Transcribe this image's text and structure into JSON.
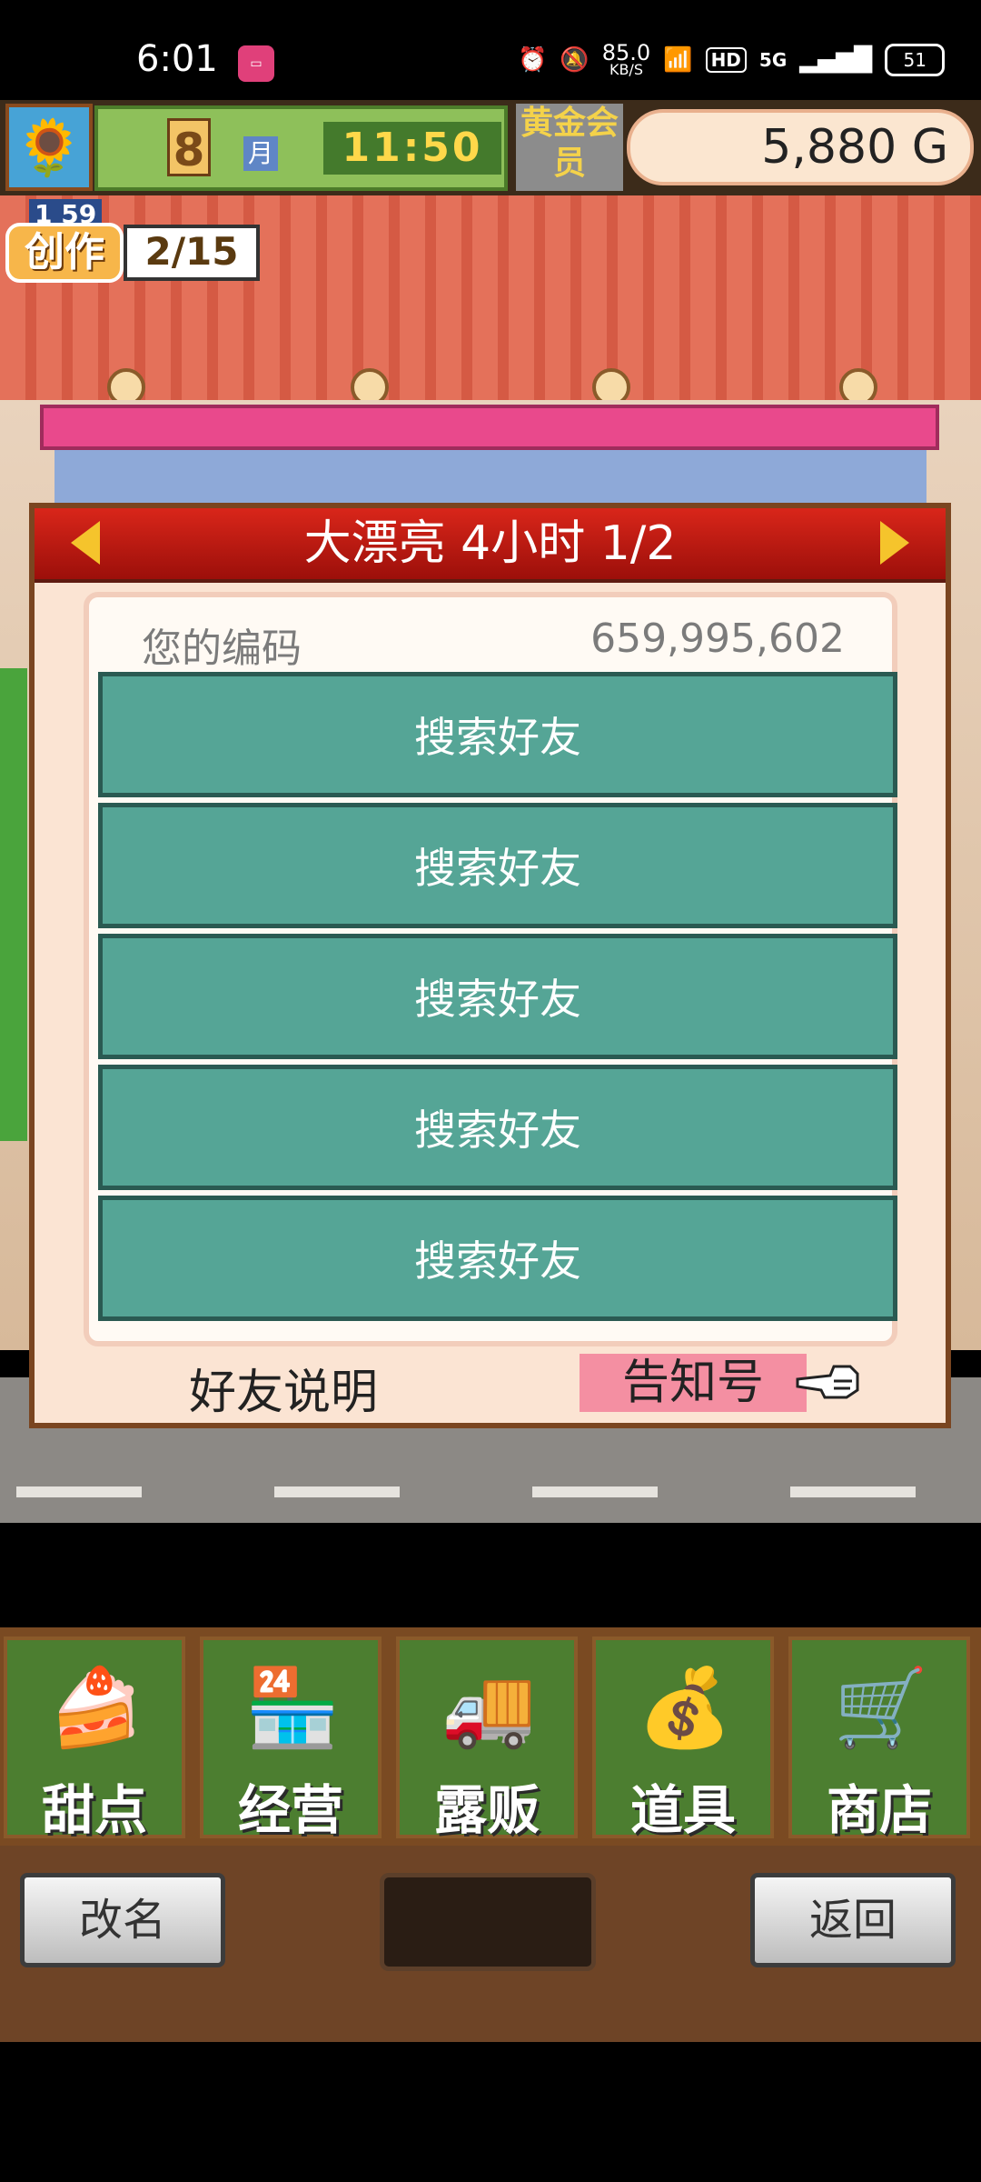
{
  "status_bar": {
    "time": "6:01",
    "app_icon": "bilibili",
    "net_speed": "85.0",
    "net_unit": "KB/S",
    "hd": "HD",
    "network": "5G",
    "battery": "51"
  },
  "hud": {
    "month": "8",
    "month_unit": "月",
    "clock": "11:50",
    "member_label": "黄金会员",
    "gold": "5,880 G"
  },
  "craft": {
    "timer": "1 59",
    "label": "创作",
    "count": "2/15"
  },
  "dialog": {
    "title": "大漂亮  4小时 1/2",
    "code_label": "您的编码",
    "code_value": "659,995,602",
    "friend_slots": [
      "搜索好友",
      "搜索好友",
      "搜索好友",
      "搜索好友",
      "搜索好友"
    ],
    "friend_help": "好友说明",
    "notify_code": "告知号"
  },
  "menu": {
    "tabs": [
      {
        "label": "甜点",
        "icon": "cake-icon"
      },
      {
        "label": "经营",
        "icon": "shop-icon"
      },
      {
        "label": "露贩",
        "icon": "food-truck-icon"
      },
      {
        "label": "道具",
        "icon": "items-icon"
      },
      {
        "label": "商店",
        "icon": "cart-icon"
      }
    ]
  },
  "bottom": {
    "rename": "改名",
    "back": "返回"
  }
}
